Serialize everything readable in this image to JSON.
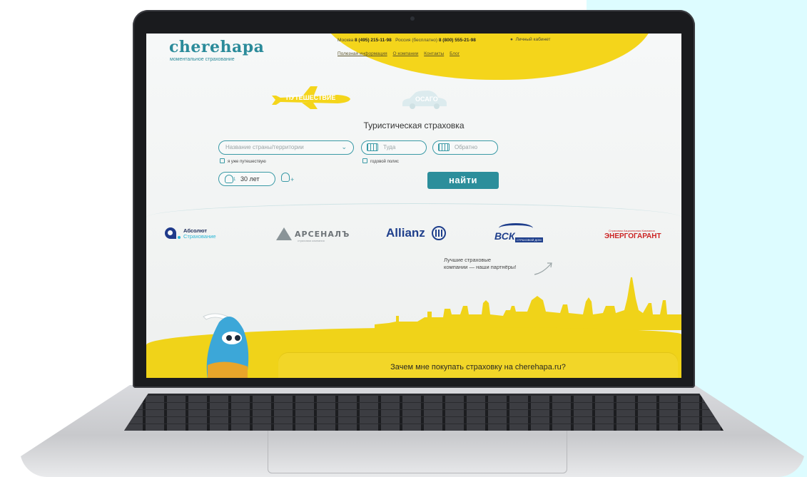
{
  "site": {
    "logo": "cherehapa",
    "tagline": "моментальное страхование"
  },
  "header": {
    "moscow_label": "Москва",
    "moscow_phone": "8 (495) 215-11-98",
    "russia_label": "Россия (бесплатно)",
    "russia_phone": "8 (800) 555-21-98",
    "account_label": "Личный кабинет",
    "nav": [
      "Полезная информация",
      "О компании",
      "Контакты",
      "Блог"
    ]
  },
  "tabs": {
    "travel": "ПУТЕШЕСТВИЕ",
    "osago": "ОСАГО"
  },
  "form": {
    "title": "Туристическая страховка",
    "country_placeholder": "Название страны/территории",
    "date_there_placeholder": "Туда",
    "date_back_placeholder": "Обратно",
    "already_traveling": "я уже путешествую",
    "annual_policy": "годовой полис",
    "traveler_count": "1",
    "age_value": "30 лет",
    "add_traveler": "+",
    "find_button": "найти"
  },
  "partners": {
    "absolut_line1": "Абсолют",
    "absolut_line2": "Страхование",
    "arsenal": "АРСЕНАЛЪ",
    "arsenal_sub": "страховая компания",
    "allianz": "Allianz",
    "vsk": "ВСК",
    "vsk_sub": "СТРАХОВОЙ ДОМ",
    "energo_sub": "Страховая Акционерная Компания",
    "energo": "ЭНЕРГОГАРАНТ",
    "note_line1": "Лучшие страховые",
    "note_line2": "компании — наши партнёры!"
  },
  "footer": {
    "why_text": "Зачем мне покупать страховку на cherehapa.ru?"
  },
  "colors": {
    "brand_teal": "#2c8e9b",
    "brand_yellow": "#f4d51b",
    "side_panel": "#ddfcff"
  }
}
